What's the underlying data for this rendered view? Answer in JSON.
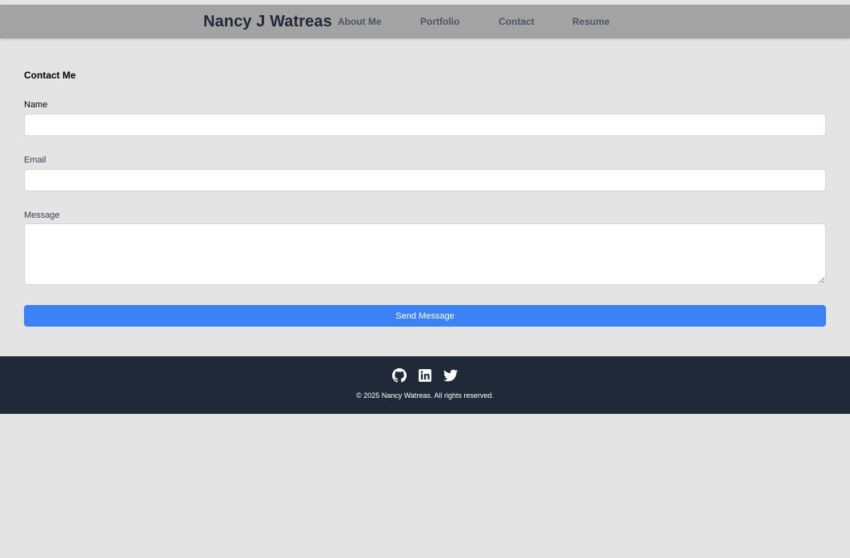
{
  "header": {
    "brand": "Nancy J Watreas",
    "nav": [
      {
        "label": "About Me"
      },
      {
        "label": "Portfolio"
      },
      {
        "label": "Contact"
      },
      {
        "label": "Resume"
      }
    ]
  },
  "contact": {
    "title": "Contact Me",
    "name_label": "Name",
    "name_value": "",
    "name_placeholder": "",
    "email_label": "Email",
    "email_value": "",
    "email_placeholder": "",
    "message_label": "Message",
    "message_value": "",
    "message_placeholder": "",
    "submit_label": "Send Message"
  },
  "footer": {
    "social_icons": [
      "github-icon",
      "linkedin-icon",
      "twitter-icon"
    ],
    "copyright": "© 2025 Nancy Watreas. All rights reserved."
  },
  "colors": {
    "page_background": "#e4e4e4",
    "navbar_background": "#a3a3a3",
    "brand_text": "#1f2937",
    "nav_text": "#4b5563",
    "button_accent": "#3b82f6",
    "footer_background": "#1f2937",
    "footer_text": "#ffffff"
  }
}
